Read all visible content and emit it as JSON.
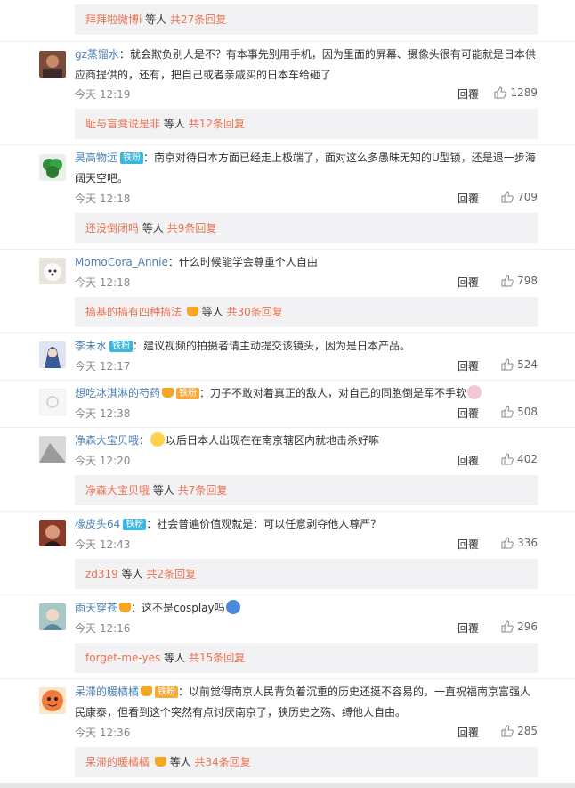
{
  "common": {
    "reply_label": "回覆"
  },
  "reply_bars": [
    {
      "name": "拜拜啦微博i",
      "suffix": "等人",
      "count": "共27条回复"
    },
    {
      "name": "耻与盲凳说是非",
      "suffix": "等人",
      "count": "共12条回复"
    },
    {
      "name": "还没倒闭吗",
      "suffix": "等人",
      "count": "共9条回复"
    },
    {
      "name": "搞基的搞有四种搞法",
      "suffix": "等人",
      "count": "共30条回复"
    },
    {
      "name": "净森大宝贝哦",
      "suffix": "等人",
      "count": "共7条回复"
    },
    {
      "name": "zd319",
      "suffix": "等人",
      "count": "共2条回复"
    },
    {
      "name": "forget-me-yes",
      "suffix": "等人",
      "count": "共15条回复"
    },
    {
      "name": "呆滞的暖橘橘",
      "suffix": "等人",
      "count": "共34条回复"
    }
  ],
  "comments": [
    {
      "user": "gz蒸馏水",
      "badge": "",
      "text": "：就会欺负别人是不？有本事先别用手机，因为里面的屏幕、摄像头很有可能就是日本供应商提供的，还有，把自己或者亲戚买的日本车给砸了",
      "time": "今天 12:19",
      "likes": "1289",
      "avatar_color": "#7a4a3a"
    },
    {
      "user": "昊高物远",
      "badge": "铁粉",
      "text": "：南京对待日本方面已经走上极端了，面对这么多愚昧无知的U型锁，还是退一步海阔天空吧。",
      "time": "今天 12:18",
      "likes": "709",
      "avatar_color": "#2e8b3a"
    },
    {
      "user": "MomoCora_Annie",
      "badge": "",
      "text": "：什么时候能学会尊重个人自由",
      "time": "今天 12:18",
      "likes": "798",
      "avatar_color": "#d9d2c8"
    },
    {
      "user": "李未水",
      "badge": "铁粉",
      "text": "：建议视频的拍摄者请主动提交该镜头，因为是日本产品。",
      "time": "今天 12:17",
      "likes": "524",
      "avatar_color": "#3a5a9a"
    },
    {
      "user": "想吃冰淇淋的芍药",
      "badge": "铁粉",
      "text": "：刀子不敢对着真正的敌人，对自己的同胞倒是军不手软",
      "time": "今天 12:38",
      "likes": "508",
      "avatar_color": "#f2f2f2"
    },
    {
      "user": "净森大宝贝哦",
      "badge": "",
      "text": "以后日本人出现在在南京辖区内就地击杀好嘛",
      "time": "今天 12:20",
      "likes": "402",
      "avatar_color": "#c9c9c9"
    },
    {
      "user": "橡皮头64",
      "badge": "铁粉",
      "text": "：社会普遍价值观就是：可以任意剥夺他人尊严？",
      "time": "今天 12:43",
      "likes": "336",
      "avatar_color": "#8a3a2a"
    },
    {
      "user": "雨天穿苍",
      "badge": "",
      "text": "：这不是cosplay吗",
      "time": "今天 12:16",
      "likes": "296",
      "avatar_color": "#5a8a9a"
    },
    {
      "user": "呆滞的暖橘橘",
      "badge": "铁粉",
      "text": "：以前觉得南京人民背负着沉重的历史还挺不容易的，一直祝福南京富强人民康泰，但看到这个突然有点讨厌南京了，狭历史之殇、缚他人自由。",
      "time": "今天 12:36",
      "likes": "285",
      "avatar_color": "#f07a3a"
    }
  ]
}
